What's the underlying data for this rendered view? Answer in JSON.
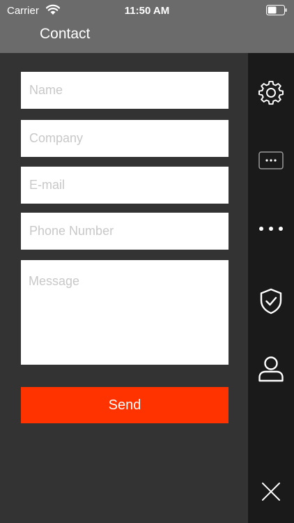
{
  "status": {
    "carrier": "Carrier",
    "time": "11:50 AM"
  },
  "header": {
    "title": "Contact"
  },
  "form": {
    "name_placeholder": "Name",
    "company_placeholder": "Company",
    "email_placeholder": "E-mail",
    "phone_placeholder": "Phone Number",
    "message_placeholder": "Message",
    "send_label": "Send"
  },
  "sidebar": {
    "icons": [
      "gear-icon",
      "chat-bubble-icon",
      "more-dots-icon",
      "shield-check-icon",
      "user-icon",
      "close-icon"
    ]
  },
  "colors": {
    "accent": "#ff3300",
    "header_bg": "#6b6b6b",
    "content_bg": "#333333",
    "sidebar_bg": "#1a1a1a"
  }
}
